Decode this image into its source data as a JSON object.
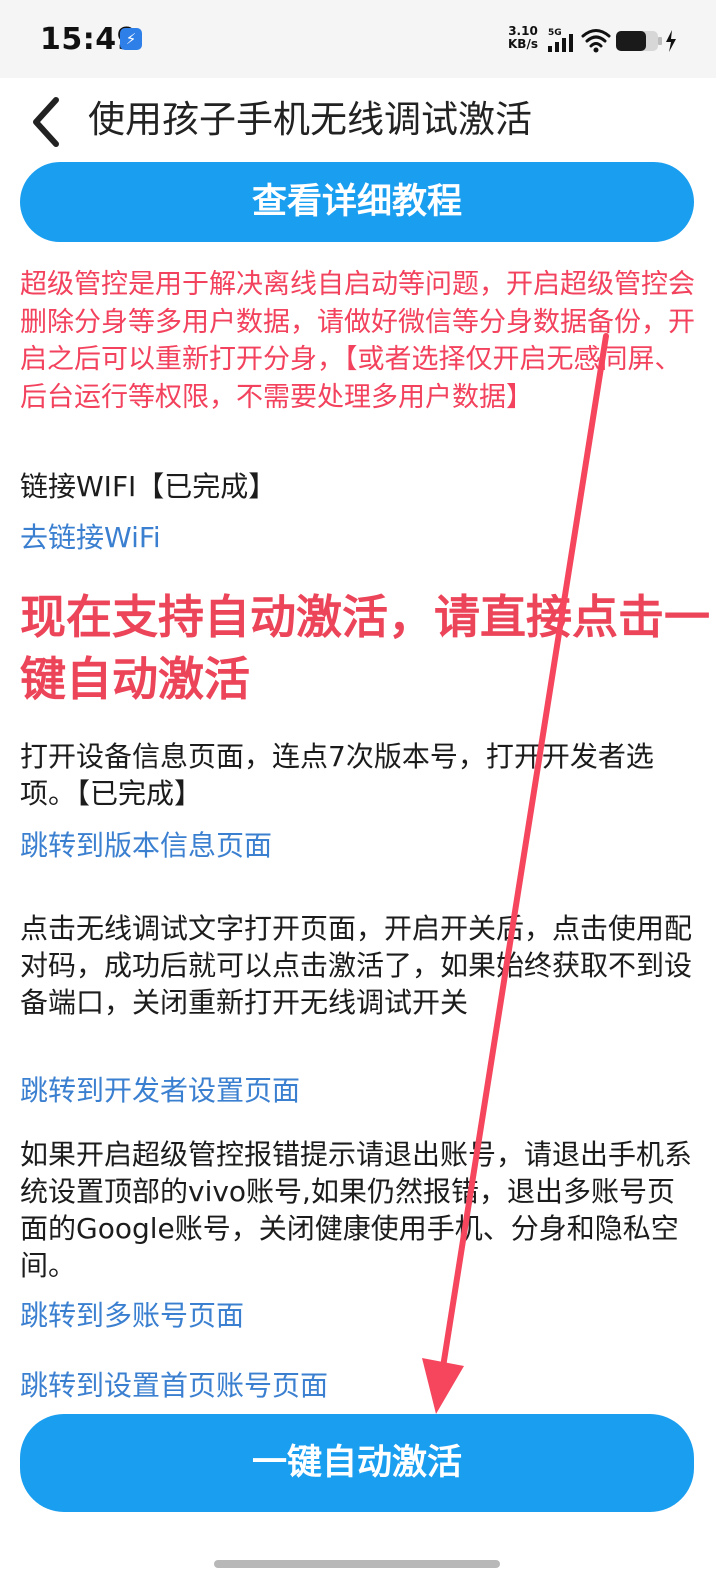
{
  "status_bar": {
    "time": "15:49",
    "net_speed_value": "3.10",
    "net_speed_unit": "KB/s",
    "network_type": "5G"
  },
  "header": {
    "title": "使用孩子手机无线调试激活"
  },
  "buttons": {
    "tutorial_label": "查看详细教程",
    "activate_label": "一键自动激活"
  },
  "notice": {
    "text": "超级管控是用于解决离线自启动等问题，开启超级管控会删除分身等多用户数据，请做好微信等分身数据备份，开启之后可以重新打开分身，【或者选择仅开启无感同屏、后台运行等权限，不需要处理多用户数据】"
  },
  "steps": {
    "wifi_status": "链接WIFI【已完成】",
    "wifi_link": "去链接WiFi",
    "auto_activate_notice": "现在支持自动激活，请直接点击一键自动激活",
    "developer_options_status": "打开设备信息页面，连点7次版本号，打开开发者选项。【已完成】",
    "version_info_link": "跳转到版本信息页面",
    "wireless_debug_instruction": "点击无线调试文字打开页面，开启开关后，点击使用配对码，成功后就可以点击激活了，如果始终获取不到设备端口，关闭重新打开无线调试开关",
    "developer_settings_link": "跳转到开发者设置页面",
    "super_control_error_tip": "如果开启超级管控报错提示请退出账号，请退出手机系统设置顶部的vivo账号,如果仍然报错，退出多账号页面的Google账号，关闭健康使用手机、分身和隐私空间。",
    "multi_account_link": "跳转到多账号页面",
    "settings_account_link": "跳转到设置首页账号页面"
  },
  "colors": {
    "accent_blue": "#1a9ef0",
    "link_blue": "#3a7fd0",
    "warning_red": "#f3425d",
    "annotation_arrow": "#f5465e"
  },
  "icons": {
    "usb": "usb-debug-icon",
    "signal": "cellular-signal-icon",
    "wifi": "wifi-icon",
    "battery": "battery-charging-icon",
    "back": "chevron-left-icon"
  }
}
